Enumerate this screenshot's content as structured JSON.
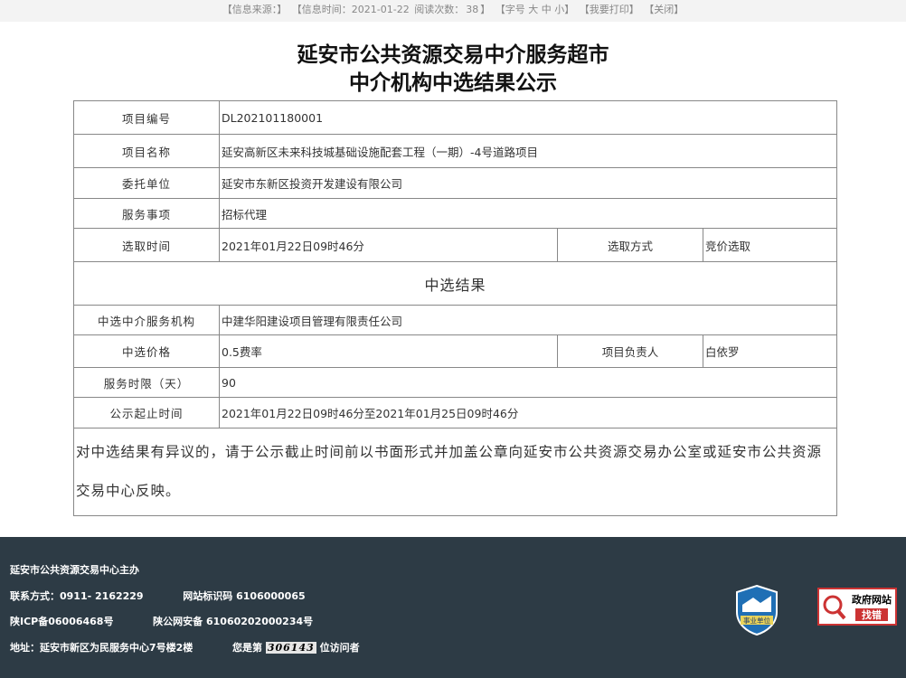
{
  "topbar": {
    "source": "【信息来源：】",
    "time": "【信息时间：2021-01-22",
    "reads_label": "阅读次数：",
    "reads": "38",
    "reads_close": "】",
    "font_size": "【字号 大 中 小】",
    "print": "【我要打印】",
    "close": "【关闭】"
  },
  "title": {
    "line1": "延安市公共资源交易中介服务超市",
    "line2": "中介机构中选结果公示"
  },
  "table": {
    "project_no_label": "项目编号",
    "project_no": "DL202101180001",
    "project_name_label": "项目名称",
    "project_name": "延安高新区未来科技城基础设施配套工程（一期）-4号道路项目",
    "client_label": "委托单位",
    "client": "延安市东新区投资开发建设有限公司",
    "service_label": "服务事项",
    "service": "招标代理",
    "select_time_label": "选取时间",
    "select_time": "2021年01月22日09时46分",
    "select_method_label": "选取方式",
    "select_method": "竞价选取",
    "result_header": "中选结果",
    "agency_label": "中选中介服务机构",
    "agency": "中建华阳建设项目管理有限责任公司",
    "price_label": "中选价格",
    "price": "0.5费率",
    "manager_label": "项目负责人",
    "manager": "白依罗",
    "duration_label": "服务时限（天）",
    "duration": "90",
    "period_label": "公示起止时间",
    "period": "2021年01月22日09时46分至2021年01月25日09时46分",
    "note": "对中选结果有异议的，请于公示截止时间前以书面形式并加盖公章向延安市公共资源交易办公室或延安市公共资源交易中心反映。"
  },
  "footer": {
    "host": "延安市公共资源交易中心主办",
    "contact": "联系方式：0911- 2162229",
    "site_id": "网站标识码 6106000065",
    "icp": "陕ICP备06006468号",
    "police": "陕公网安备 61060202000234号",
    "address": "地址：延安市新区为民服务中心7号楼2楼",
    "visitor_pre": "您是第",
    "visitor_count": "306143",
    "visitor_post": "位访问者",
    "badge_text": "事业单位",
    "gov_text1": "政府网站",
    "gov_text2": "找错"
  }
}
